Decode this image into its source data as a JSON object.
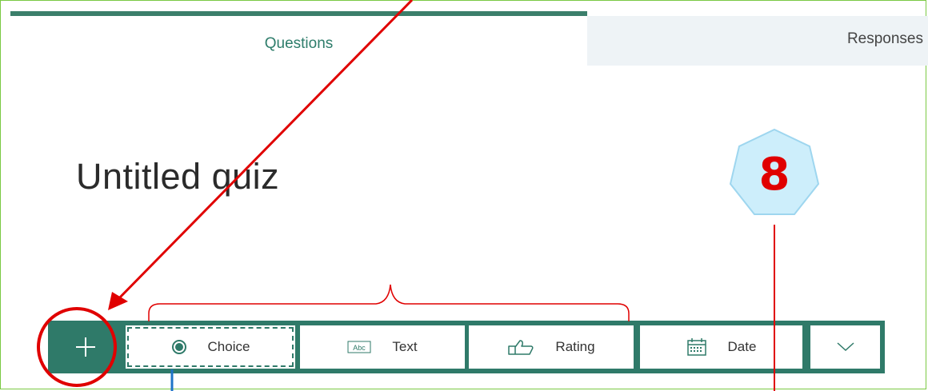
{
  "tabs": {
    "questions": "Questions",
    "responses": "Responses"
  },
  "quiz": {
    "title": "Untitled quiz"
  },
  "toolbar": {
    "add_label": "+",
    "choice": "Choice",
    "text": "Text",
    "rating": "Rating",
    "date": "Date",
    "text_icon_label": "Abc"
  },
  "annotation": {
    "step_number": "8"
  },
  "colors": {
    "accent": "#2f7a69",
    "annotation_red": "#e00000",
    "badge_fill": "#cdeefb"
  }
}
